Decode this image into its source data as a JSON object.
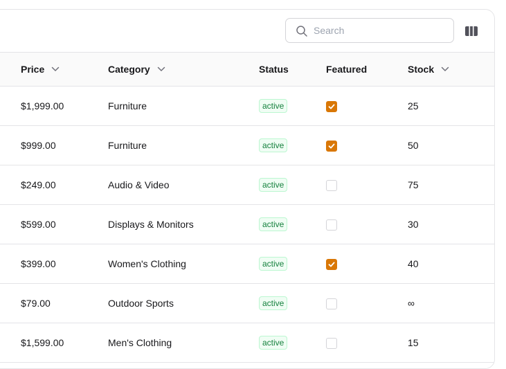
{
  "search": {
    "placeholder": "Search",
    "value": ""
  },
  "toolbar": {
    "columns_icon": "columns-icon"
  },
  "colors": {
    "accent": "#d97706",
    "status_active_text": "#15803d",
    "status_active_bg": "#f0fdf4",
    "border": "#e4e4e7"
  },
  "columns": {
    "price": "Price",
    "category": "Category",
    "status": "Status",
    "featured": "Featured",
    "stock": "Stock"
  },
  "rows": [
    {
      "price": "$1,999.00",
      "category": "Furniture",
      "status": "active",
      "featured": true,
      "stock": "25"
    },
    {
      "price": "$999.00",
      "category": "Furniture",
      "status": "active",
      "featured": true,
      "stock": "50"
    },
    {
      "price": "$249.00",
      "category": "Audio & Video",
      "status": "active",
      "featured": false,
      "stock": "75"
    },
    {
      "price": "$599.00",
      "category": "Displays & Monitors",
      "status": "active",
      "featured": false,
      "stock": "30"
    },
    {
      "price": "$399.00",
      "category": "Women's Clothing",
      "status": "active",
      "featured": true,
      "stock": "40"
    },
    {
      "price": "$79.00",
      "category": "Outdoor Sports",
      "status": "active",
      "featured": false,
      "stock": "∞"
    },
    {
      "price": "$1,599.00",
      "category": "Men's Clothing",
      "status": "active",
      "featured": false,
      "stock": "15"
    }
  ]
}
